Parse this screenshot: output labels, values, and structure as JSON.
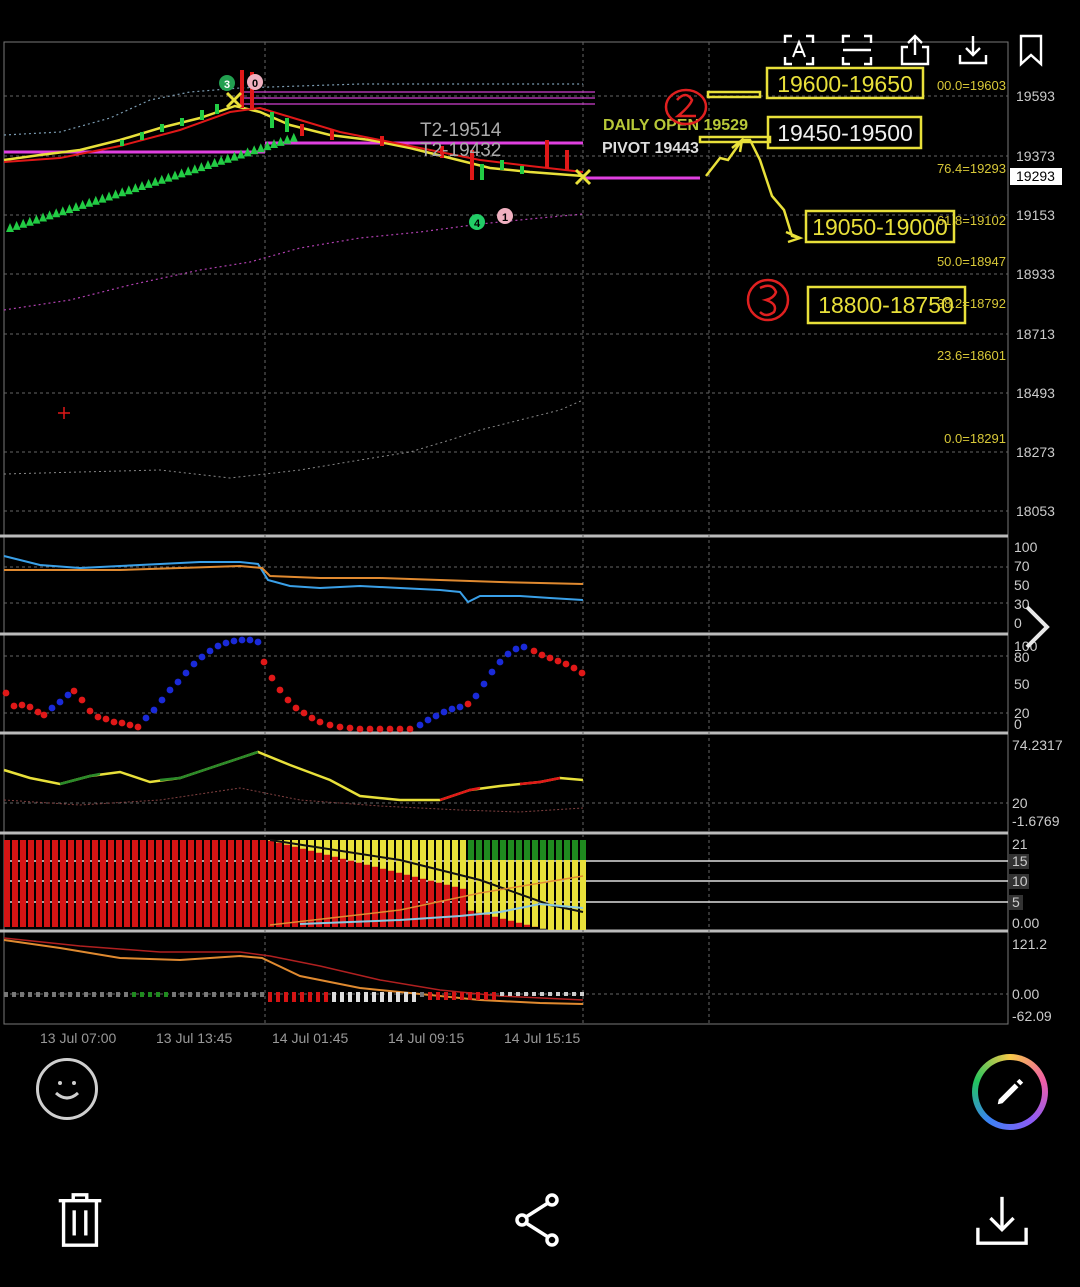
{
  "toolbar": {
    "icons": [
      "text-recognition-icon",
      "scan-icon",
      "share-upload-icon",
      "download-icon",
      "bookmark-icon"
    ]
  },
  "chart": {
    "price_axis": [
      "19593",
      "19373",
      "19293",
      "19153",
      "18933",
      "18713",
      "18493",
      "18273",
      "18053"
    ],
    "fib_levels": [
      "00.0=19603",
      "76.4=19293",
      "61.8=19102",
      "50.0=18947",
      "38.2=18792",
      "23.6=18601",
      "0.0=18291"
    ],
    "labels": {
      "t2a": "T2-19514",
      "t2b": "T2-19432",
      "daily_open": "DAILY OPEN 19529",
      "pivot": "PIVOT 19443"
    },
    "zones": {
      "z1": "19600-19650",
      "z2": "19450-19500",
      "z3": "19050-19000",
      "z4": "18800-18750"
    },
    "markers": [
      "3",
      "0",
      "4",
      "1"
    ],
    "rsi_axis": [
      "100",
      "70",
      "50",
      "30",
      "0"
    ],
    "stoch_axis": [
      "100",
      "80",
      "50",
      "20",
      "0"
    ],
    "adx_axis": [
      "74.2317",
      "20",
      "-1.6769"
    ],
    "vol_axis": [
      "21",
      "15",
      "10",
      "5",
      "0.00"
    ],
    "macd_axis": [
      "121.2",
      "0.00",
      "-62.09"
    ],
    "time_axis": [
      "13 Jul 07:00",
      "13 Jul 13:45",
      "14 Jul 01:45",
      "14 Jul 09:15",
      "14 Jul 15:15"
    ]
  },
  "colors": {
    "yellow": "#e8e03a",
    "magenta": "#e040e0",
    "green": "#22cc44",
    "red": "#e01818",
    "blue": "#3aa0e8",
    "orange": "#e08a30",
    "hand_red": "#e02020"
  }
}
